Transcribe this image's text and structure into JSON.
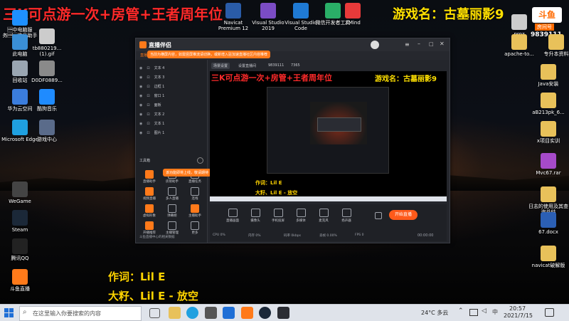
{
  "overlay": {
    "left_text": "三K可点游一次+房管+王者周年位",
    "right_text": "游戏名：古墓丽影9",
    "platform_logo": "斗鱼",
    "room_label": "房间号",
    "room_number": "9839111"
  },
  "lyrics": {
    "line1": "作词：Lil E",
    "line2": "大籽、Lil E - 放空"
  },
  "desktop_left": [
    {
      "label": "\u0001中电脑服务\u0001\u0001信息助手",
      "icon": "monitor-icon",
      "color": "#1e90ff"
    },
    {
      "label": "tb880219...(1).gif",
      "icon": "file-icon",
      "color": "#cccccc"
    },
    {
      "label": "此电脑",
      "icon": "pc-icon",
      "color": "#3a8fd6"
    },
    {
      "label": "回收站",
      "icon": "recycle-bin-icon",
      "color": "#9aa6b2"
    },
    {
      "label": "D0DF0889...",
      "icon": "image-file-icon",
      "color": "#8a8a8a"
    },
    {
      "label": "华为云空间",
      "icon": "cloud-icon",
      "color": "#3b7ddd"
    },
    {
      "label": "酷狗音乐",
      "icon": "music-icon",
      "color": "#1f8bff"
    },
    {
      "label": "Microsoft Edge",
      "icon": "edge-icon",
      "color": "#1fa0e0"
    },
    {
      "label": "游戏中心",
      "icon": "game-icon",
      "color": "#5a6b8a"
    },
    {
      "label": "WeGame",
      "icon": "wegame-icon",
      "color": "#444444"
    },
    {
      "label": "Steam",
      "icon": "steam-icon",
      "color": "#1b2838"
    },
    {
      "label": "腾讯QQ",
      "icon": "qq-icon",
      "color": "#222222"
    },
    {
      "label": "斗鱼直播",
      "icon": "douyu-icon",
      "color": "#ff7a1a"
    }
  ],
  "desktop_top": [
    {
      "label": "Navicat Premium 12",
      "icon": "navicat-icon",
      "color": "#2a5ca8"
    },
    {
      "label": "Visual Studio 2019",
      "icon": "vs-icon",
      "color": "#7b4cc4"
    },
    {
      "label": "Visual Studio Code",
      "icon": "vscode-icon",
      "color": "#1f7ad4"
    },
    {
      "label": "微信开发者工具",
      "icon": "wechat-dev-icon",
      "color": "#2aae67"
    },
    {
      "label": "XMind",
      "icon": "xmind-icon",
      "color": "#e83a3a"
    }
  ],
  "desktop_right": [
    {
      "label": "proz",
      "icon": "file-icon",
      "color": "#cccccc"
    },
    {
      "label": "apache-to...",
      "icon": "folder-icon",
      "color": "#e8c15a"
    },
    {
      "label": "专升本资料",
      "icon": "folder-icon",
      "color": "#e8c15a"
    },
    {
      "label": "Java安装",
      "icon": "folder-icon",
      "color": "#e8c15a"
    },
    {
      "label": "aB213pk_6...",
      "icon": "folder-icon",
      "color": "#e8c15a"
    },
    {
      "label": "x项目实训",
      "icon": "folder-icon",
      "color": "#e8c15a"
    },
    {
      "label": "Mvc67.rar",
      "icon": "archive-icon",
      "color": "#a64ac9"
    },
    {
      "label": "日志的使用及其查询总结",
      "icon": "folder-icon",
      "color": "#e8c15a"
    },
    {
      "label": "67.docx",
      "icon": "word-icon",
      "color": "#2b5fb4"
    },
    {
      "label": "navicat破解版",
      "icon": "folder-icon",
      "color": "#e8c15a"
    }
  ],
  "app": {
    "name": "直播伴侣",
    "menu": [
      "直播场景",
      "直播",
      "互动",
      "粉丝",
      "+",
      "场景设置",
      "特效与画质",
      "设置"
    ],
    "notice": "当前为横屏内容，如需竖屏推流请切换，或新增入驻加速直播社区内容推荐",
    "subbar": [
      "场景设置",
      "设置直播间",
      "9839111",
      "7365"
    ],
    "layers": [
      "文本 4",
      "文本 3",
      "边框 1",
      "窗口 1",
      "面板",
      "文本 2",
      "文本 1",
      "图片 1"
    ],
    "section_label": "工具箱",
    "tools": [
      [
        "直播助手",
        "房管助手",
        "直播任务"
      ],
      [
        "视频直播",
        "多人直播",
        "连线"
      ],
      [
        "虚拟形象",
        "弹幕姬",
        "主播助手"
      ],
      [
        "开播推荐",
        "主播管理",
        "更多"
      ]
    ],
    "toast": "该功能即将上线，敬请期待",
    "footer": "斗鱼直播中心的相关数据",
    "bottom_tools": [
      "直播画面",
      "摄像头",
      "手机投屏",
      "多媒体",
      "麦克风",
      "扬声器"
    ],
    "start_button": "开始直播",
    "status": [
      "CPU 0%",
      "内存 0%",
      "码率 0kbps",
      "丢帧 0.00%",
      "FPS 0"
    ],
    "timer": "00:00:00"
  },
  "taskbar": {
    "search_placeholder": "在这里输入你要搜索的内容",
    "weather": "24°C 多云",
    "time": "20:57",
    "date": "2021/7/15"
  }
}
